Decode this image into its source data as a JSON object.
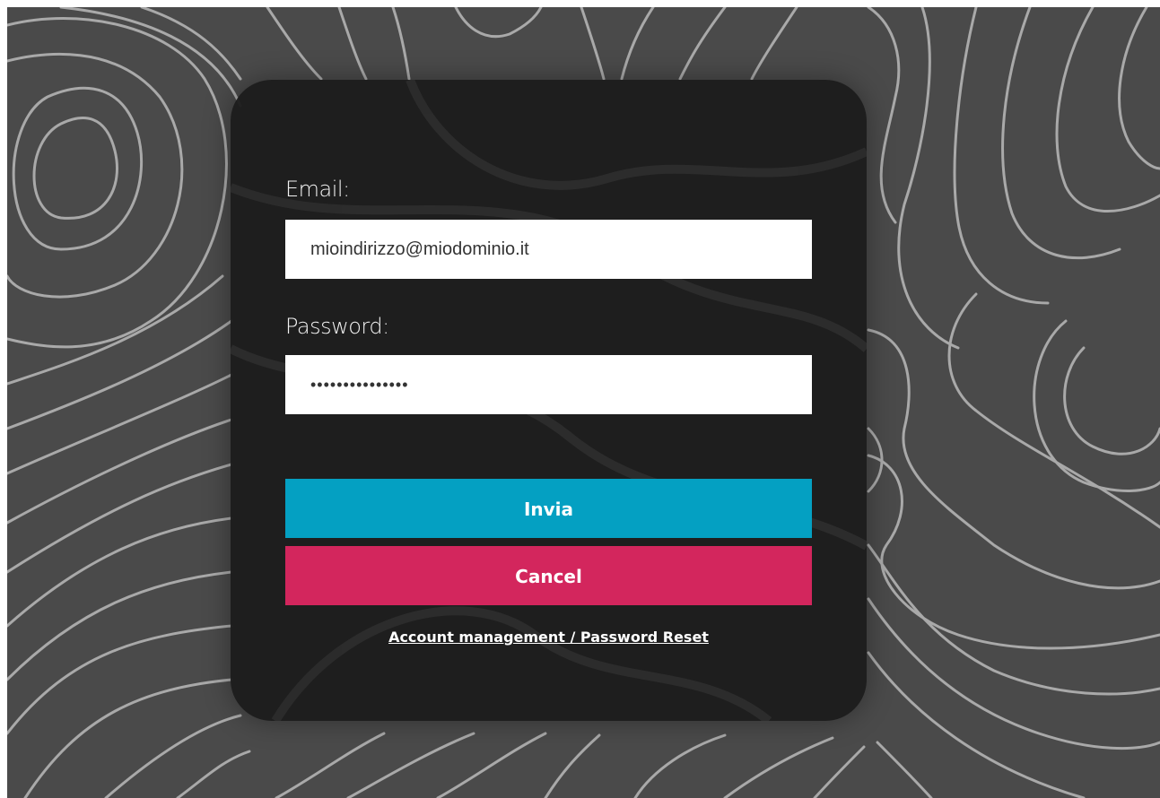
{
  "login": {
    "email_label": "Email:",
    "email_value": "mioindirizzo@miodominio.it",
    "password_label": "Password:",
    "password_value": "passwordpasswor",
    "submit_label": "Invia",
    "cancel_label": "Cancel",
    "account_link": "Account management / Password Reset"
  },
  "colors": {
    "background": "#4a4a4a",
    "card": "#1c1c1c",
    "submit": "#04a0c2",
    "cancel": "#d3265d",
    "contour_lines": "#a9a9a9"
  }
}
